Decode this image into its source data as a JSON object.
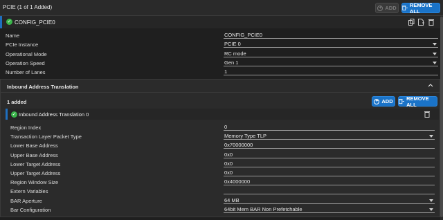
{
  "header": {
    "title": "PCIE (1 of 1 Added)",
    "add_label": "ADD",
    "remove_all_label": "REMOVE ALL"
  },
  "instance": {
    "name": "CONFIG_PCIE0"
  },
  "fields": [
    {
      "label": "Name",
      "value": "CONFIG_PCIE0",
      "type": "text"
    },
    {
      "label": "PCIe Instance",
      "value": "PCIE 0",
      "type": "select"
    },
    {
      "label": "Operational Mode",
      "value": "RC mode",
      "type": "select"
    },
    {
      "label": "Operation Speed",
      "value": "Gen 1",
      "type": "select"
    },
    {
      "label": "Number of Lanes",
      "value": "1",
      "type": "text"
    }
  ],
  "inbound": {
    "title": "Inbound Address Translation",
    "added_count": "1 added",
    "add_label": "ADD",
    "remove_all_label": "REMOVE ALL",
    "instance_name": "Inbound Address Translation 0",
    "fields": [
      {
        "label": "Region Index",
        "value": "0",
        "type": "text"
      },
      {
        "label": "Transaction Layer Packet Type",
        "value": "Memory Type TLP",
        "type": "select"
      },
      {
        "label": "Lower Base Address",
        "value": "0x70000000",
        "type": "text"
      },
      {
        "label": "Upper Base Address",
        "value": "0x0",
        "type": "text"
      },
      {
        "label": "Lower Target Address",
        "value": "0x0",
        "type": "text"
      },
      {
        "label": "Upper Target Address",
        "value": "0x0",
        "type": "text"
      },
      {
        "label": "Region Window Size",
        "value": "0x4000000",
        "type": "text"
      },
      {
        "label": "Extern Variables",
        "value": "",
        "type": "text"
      },
      {
        "label": "BAR Aperture",
        "value": "64 MB",
        "type": "select"
      },
      {
        "label": "Bar Configuration",
        "value": "64bit Mem BAR Non Prefetchable",
        "type": "select"
      }
    ]
  }
}
